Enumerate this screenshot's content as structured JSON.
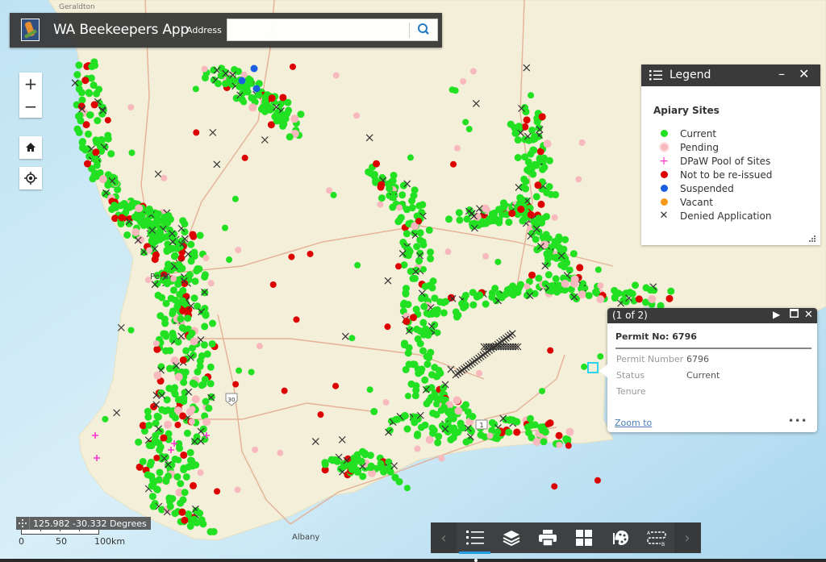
{
  "header": {
    "app_title": "WA Beekeepers App",
    "address_label": "Address",
    "address_value": "",
    "address_placeholder": "",
    "logo_icon": "banksia-logo-icon",
    "search_icon": "search-icon"
  },
  "map_controls": {
    "zoom_in": "+",
    "zoom_out": "−",
    "home_icon": "home-icon",
    "locate_icon": "locate-icon"
  },
  "map_labels": {
    "perth": "Perth",
    "albany": "Albany",
    "geraldton": "Geraldton",
    "road_30": "30",
    "road_1": "1"
  },
  "legend": {
    "title": "Legend",
    "layer_title": "Apiary Sites",
    "items": [
      {
        "label": "Current",
        "symbol": "dot",
        "color": "#22e022"
      },
      {
        "label": "Pending",
        "symbol": "ring-dot",
        "color": "#f7b9bd"
      },
      {
        "label": "DPaW Pool of Sites",
        "symbol": "plus",
        "color": "#ff33cc"
      },
      {
        "label": "Not to be re-issued",
        "symbol": "dot",
        "color": "#dd0000"
      },
      {
        "label": "Suspended",
        "symbol": "dot",
        "color": "#1a5fe0"
      },
      {
        "label": "Vacant",
        "symbol": "dot",
        "color": "#f59a1b"
      },
      {
        "label": "Denied Application",
        "symbol": "x",
        "color": "#333333"
      }
    ]
  },
  "popup": {
    "count": "(1 of 2)",
    "title": "Permit No: 6796",
    "fields": [
      {
        "key": "Permit Number",
        "value": "6796"
      },
      {
        "key": "Status",
        "value": "Current"
      },
      {
        "key": "Tenure",
        "value": ""
      }
    ],
    "zoom_to": "Zoom to",
    "more": "•••"
  },
  "coordinates": {
    "text": "125.982 -30.332 Degrees"
  },
  "scalebar": {
    "labels": [
      "0",
      "50",
      "100km"
    ]
  },
  "toolbar": {
    "buttons": [
      {
        "name": "legend",
        "icon": "legend-list-icon",
        "active": true
      },
      {
        "name": "layer-list",
        "icon": "layers-icon",
        "active": false
      },
      {
        "name": "print",
        "icon": "print-icon",
        "active": false
      },
      {
        "name": "basemap-gallery",
        "icon": "grid-icon",
        "active": false
      },
      {
        "name": "draw",
        "icon": "palette-icon",
        "active": false
      },
      {
        "name": "directions",
        "icon": "directions-a-b-icon",
        "active": false
      }
    ]
  },
  "colors": {
    "current": "#22e022",
    "pending": "#f7b9bd",
    "pool": "#ff33cc",
    "not_reissued": "#dd0000",
    "suspended": "#1a5fe0",
    "vacant": "#f59a1b",
    "denied": "#333333",
    "panel_dark": "#3a3a3a",
    "accent": "#1e9be2"
  }
}
